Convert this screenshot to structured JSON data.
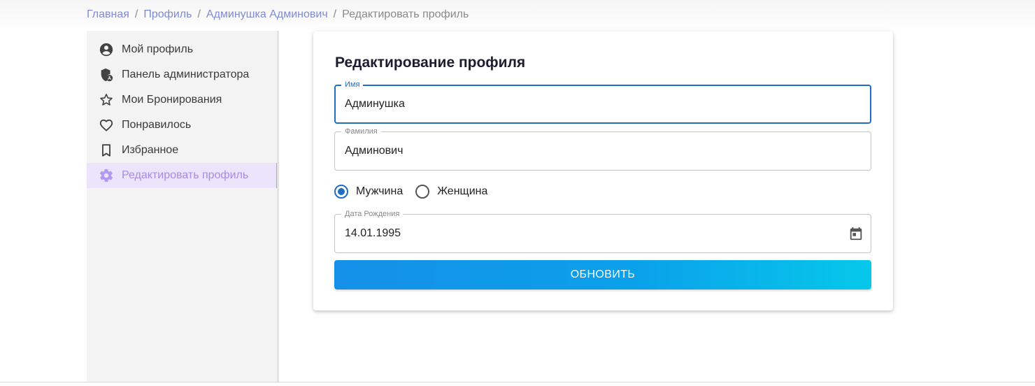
{
  "breadcrumb": {
    "home": "Главная",
    "profile": "Профиль",
    "user": "Админушка Админович",
    "current": "Редактировать профиль",
    "separator": "/"
  },
  "sidebar": {
    "items": [
      {
        "label": "Мой профиль",
        "icon": "account-circle-icon"
      },
      {
        "label": "Панель администратора",
        "icon": "admin-shield-icon"
      },
      {
        "label": "Мои Бронирования",
        "icon": "star-outline-icon"
      },
      {
        "label": "Понравилось",
        "icon": "heart-outline-icon"
      },
      {
        "label": "Избранное",
        "icon": "bookmark-outline-icon"
      },
      {
        "label": "Редактировать профиль",
        "icon": "settings-gear-icon",
        "active": true
      }
    ],
    "active_color": "#a78bea"
  },
  "form": {
    "title": "Редактирование профиля",
    "first_name": {
      "label": "Имя",
      "value": "Админушка"
    },
    "last_name": {
      "label": "Фамилия",
      "value": "Админович"
    },
    "gender": {
      "options": [
        {
          "label": "Мужчина",
          "checked": true
        },
        {
          "label": "Женщина",
          "checked": false
        }
      ]
    },
    "birth_date": {
      "label": "Дата Рождения",
      "value": "14.01.1995",
      "icon": "calendar-icon"
    },
    "submit_label": "ОБНОВИТЬ"
  },
  "colors": {
    "link": "#7f8bd6",
    "focus": "#1e6fc4",
    "button_gradient_start": "#1590e8",
    "button_gradient_end": "#06c8ea"
  }
}
